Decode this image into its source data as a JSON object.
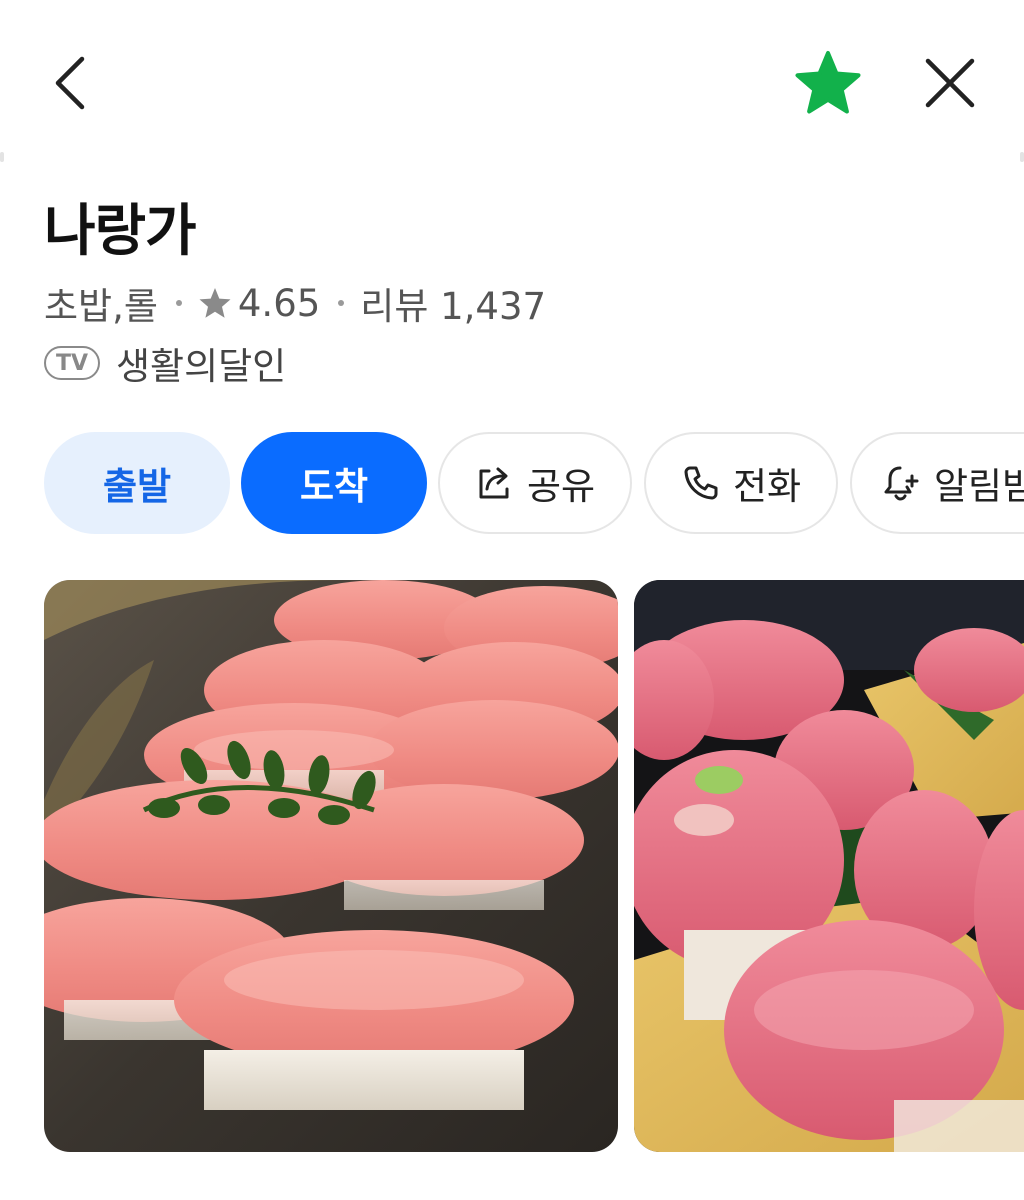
{
  "header": {
    "back_icon": "chevron-left-icon",
    "favorite_icon": "star-icon",
    "favorite_color": "#12b14b",
    "close_icon": "close-icon"
  },
  "place": {
    "name": "나랑가",
    "category": "초밥,롤",
    "rating": "4.65",
    "review_label": "리뷰 1,437",
    "tv_badge": "TV",
    "tv_program": "생활의달인"
  },
  "actions": {
    "depart": "출발",
    "arrive": "도착",
    "share": "공유",
    "call": "전화",
    "alarm": "알림받"
  },
  "colors": {
    "accent": "#0a6cff",
    "accent_light": "#e6f0fd",
    "favorite": "#12b14b"
  }
}
